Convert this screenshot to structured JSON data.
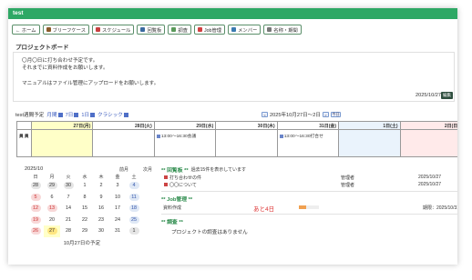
{
  "titlebar": {
    "title": "test"
  },
  "toolbar": [
    {
      "name": "home-button",
      "label": "← ホーム",
      "icon": "arrow-left-icon",
      "color": "#ffffff"
    },
    {
      "name": "briefcase-button",
      "label": "ブリーフケース",
      "icon": "briefcase-icon",
      "color": "#8a5a2a"
    },
    {
      "name": "schedule-button",
      "label": "スケジュール",
      "icon": "calendar-icon",
      "color": "#c84040"
    },
    {
      "name": "circulation-button",
      "label": "回覧板",
      "icon": "board-icon",
      "color": "#3a6aa0"
    },
    {
      "name": "survey-button",
      "label": "調査",
      "icon": "survey-icon",
      "color": "#5a9a5a"
    },
    {
      "name": "job-button",
      "label": "Job管理",
      "icon": "pin-icon",
      "color": "#d04040"
    },
    {
      "name": "member-button",
      "label": "メンバー",
      "icon": "people-icon",
      "color": "#3a7ab0"
    },
    {
      "name": "namecard-button",
      "label": "名称・期間",
      "icon": "pencil-icon",
      "color": "#777777"
    }
  ],
  "board": {
    "title": "プロジェクトボード",
    "lines": [
      "〇月〇日に打ち合わせ予定です。",
      "それまでに資料作成をお願いします。",
      "",
      "マニュアルはファイル管理にアップロードをお願いします。"
    ],
    "date": "2025/10/27",
    "edit_label": "編集"
  },
  "schedule": {
    "label": "test週間予定",
    "views": [
      "月間",
      "7日",
      "1日",
      "クラシック"
    ],
    "range": "2025年10月27日～2日",
    "nav_prev": "<",
    "nav_next": ">",
    "nav_today": "今日",
    "row_label": "員 員",
    "days": [
      {
        "label": "27日(月)",
        "type": "today",
        "events": []
      },
      {
        "label": "28日(火)",
        "type": "",
        "events": []
      },
      {
        "label": "29日(水)",
        "type": "",
        "events": [
          "13:00～16:30会議"
        ]
      },
      {
        "label": "30日(木)",
        "type": "",
        "events": []
      },
      {
        "label": "31日(金)",
        "type": "",
        "events": [
          "13:00～16:30打合せ"
        ]
      },
      {
        "label": "1日(土)",
        "type": "sat",
        "events": []
      },
      {
        "label": "2日(日)",
        "type": "sun",
        "events": []
      }
    ]
  },
  "calendar": {
    "month": "2025/10",
    "prev": "前月",
    "next": "次月",
    "weekdays": [
      "日",
      "月",
      "火",
      "水",
      "木",
      "金",
      "土"
    ],
    "cells": [
      {
        "d": "28",
        "s": "gray"
      },
      {
        "d": "29",
        "s": "gray"
      },
      {
        "d": "30",
        "s": "gray"
      },
      {
        "d": "1",
        "s": ""
      },
      {
        "d": "2",
        "s": ""
      },
      {
        "d": "3",
        "s": ""
      },
      {
        "d": "4",
        "s": "blue"
      },
      {
        "d": "5",
        "s": "red"
      },
      {
        "d": "6",
        "s": ""
      },
      {
        "d": "7",
        "s": ""
      },
      {
        "d": "8",
        "s": ""
      },
      {
        "d": "9",
        "s": ""
      },
      {
        "d": "10",
        "s": ""
      },
      {
        "d": "11",
        "s": "blue"
      },
      {
        "d": "12",
        "s": "red"
      },
      {
        "d": "13",
        "s": "red"
      },
      {
        "d": "14",
        "s": ""
      },
      {
        "d": "15",
        "s": ""
      },
      {
        "d": "16",
        "s": ""
      },
      {
        "d": "17",
        "s": ""
      },
      {
        "d": "18",
        "s": "blue"
      },
      {
        "d": "19",
        "s": "red"
      },
      {
        "d": "20",
        "s": ""
      },
      {
        "d": "21",
        "s": ""
      },
      {
        "d": "22",
        "s": ""
      },
      {
        "d": "23",
        "s": ""
      },
      {
        "d": "24",
        "s": ""
      },
      {
        "d": "25",
        "s": "blue"
      },
      {
        "d": "26",
        "s": "red"
      },
      {
        "d": "27",
        "s": "today"
      },
      {
        "d": "28",
        "s": ""
      },
      {
        "d": "29",
        "s": ""
      },
      {
        "d": "30",
        "s": ""
      },
      {
        "d": "31",
        "s": ""
      },
      {
        "d": "1",
        "s": "gray"
      }
    ],
    "footer": "10月27日の予定"
  },
  "circulation": {
    "title": "** 回覧板 **",
    "subtitle": "過去15件を表示しています",
    "items": [
      {
        "title": "打ち合わせの件",
        "who": "管理者",
        "date": "2025/10/27"
      },
      {
        "title": "〇〇について",
        "who": "管理者",
        "date": "2025/10/27"
      }
    ]
  },
  "job": {
    "title": "** Job管理 **",
    "items": [
      {
        "name": "資料作成",
        "remaining": "あと4日",
        "progress": 0.35,
        "deadline": "期限：2025/10/31"
      }
    ]
  },
  "survey": {
    "title": "** 調査 **",
    "empty_message": "プロジェクトの調査はありません"
  }
}
